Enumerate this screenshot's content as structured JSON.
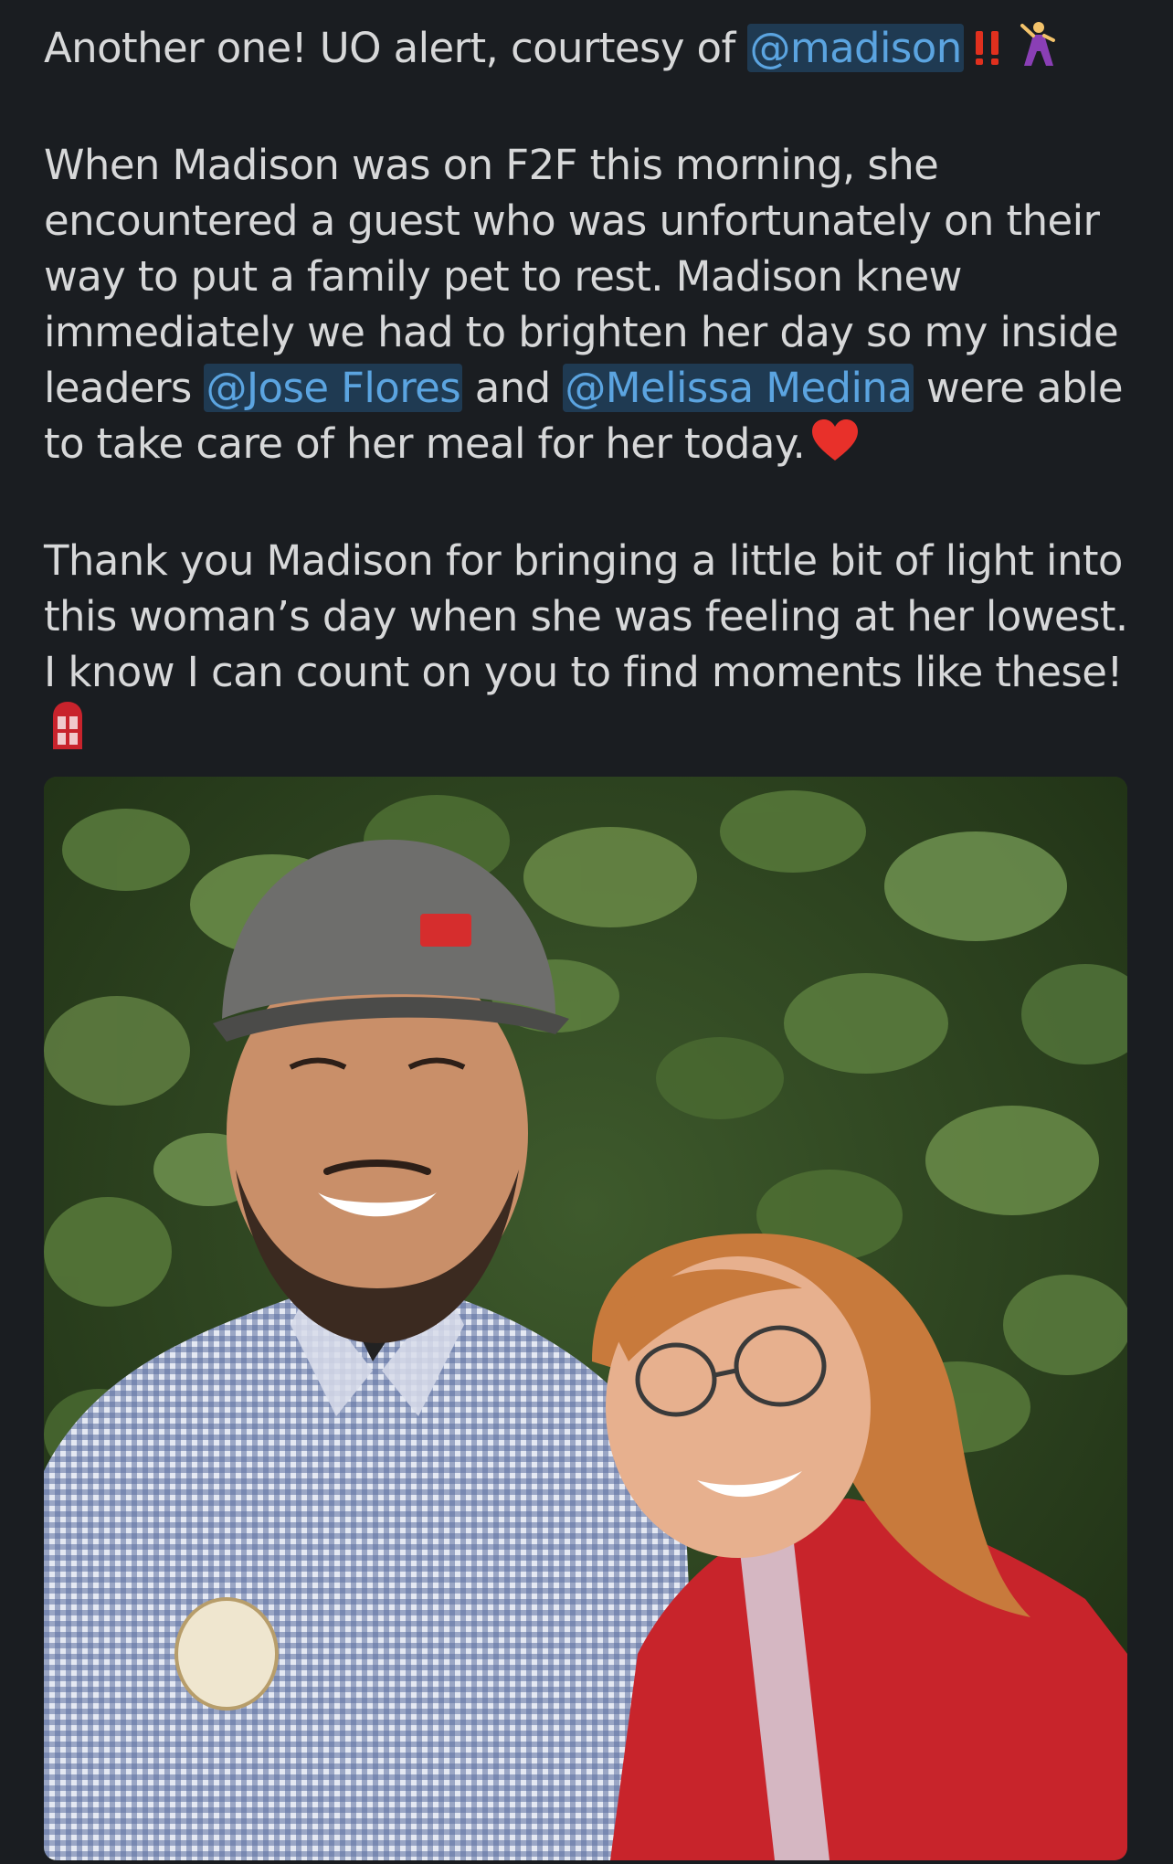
{
  "message": {
    "line1": {
      "text": "Another one! UO alert, courtesy of ",
      "mention": "@madison"
    },
    "paragraph2": {
      "part1": "When Madison was on F2F this morning, she encountered a guest who was unfortunately on their way to put a family pet to rest. Madison knew immediately we had to brighten her day so my inside leaders ",
      "mention1": "@Jose Flores",
      "part2": " and ",
      "mention2": "@Melissa Medina",
      "part3": " were able to take care of her meal for her today."
    },
    "paragraph3": {
      "text": "Thank you Madison for bringing a little bit of light into this woman’s day when she was feeling at her lowest. I know I can count on you to find moments like these!"
    },
    "emojis": [
      "double-exclamation-icon",
      "dancing-woman-icon",
      "red-heart-icon",
      "door-icon"
    ]
  },
  "colors": {
    "background": "#1a1d21",
    "text": "#d7d8d9",
    "mention_text": "#5ba4e0",
    "mention_bg": "#1f3a52"
  }
}
